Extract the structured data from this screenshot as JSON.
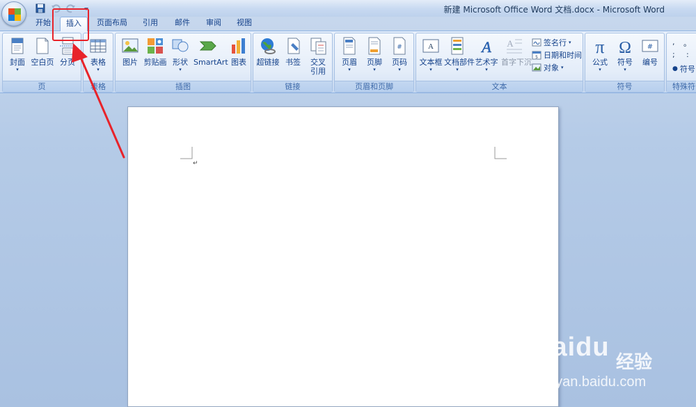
{
  "window": {
    "title": "新建 Microsoft Office Word 文档.docx - Microsoft Word"
  },
  "tabs": [
    {
      "label": "开始",
      "active": false
    },
    {
      "label": "插入",
      "active": true
    },
    {
      "label": "页面布局",
      "active": false
    },
    {
      "label": "引用",
      "active": false
    },
    {
      "label": "邮件",
      "active": false
    },
    {
      "label": "审阅",
      "active": false
    },
    {
      "label": "视图",
      "active": false
    }
  ],
  "groups": {
    "pages": {
      "label": "页",
      "cover_label": "封面",
      "blank_label": "空白页",
      "break_label": "分页"
    },
    "tables": {
      "label": "表格",
      "table_label": "表格"
    },
    "illustrations": {
      "label": "插图",
      "picture_label": "图片",
      "clipart_label": "剪贴画",
      "shapes_label": "形状",
      "smartart_label": "SmartArt",
      "chart_label": "图表"
    },
    "links": {
      "label": "链接",
      "hyperlink_label": "超链接",
      "bookmark_label": "书签",
      "crossref_label": "交叉\n引用"
    },
    "header_footer": {
      "label": "页眉和页脚",
      "header_label": "页眉",
      "footer_label": "页脚",
      "pagenum_label": "页码"
    },
    "text": {
      "label": "文本",
      "textbox_label": "文本框",
      "quickparts_label": "文档部件",
      "wordart_label": "艺术字",
      "dropcap_label": "首字下沉",
      "signature_label": "签名行",
      "datetime_label": "日期和时间",
      "object_label": "对象"
    },
    "symbols": {
      "label": "符号",
      "equation_label": "公式",
      "symbol_label": "符号",
      "number_label": "编号"
    },
    "special": {
      "label": "特殊符号",
      "symbol_label": "符号",
      "chars": [
        ",",
        "。",
        ";",
        ":"
      ]
    }
  },
  "watermark": {
    "logo_text": "Baidu",
    "cn_text": "经验",
    "url": "jingyan.baidu.com"
  },
  "colors": {
    "annotation": "#e8232a",
    "ribbon_text": "#15428b"
  }
}
